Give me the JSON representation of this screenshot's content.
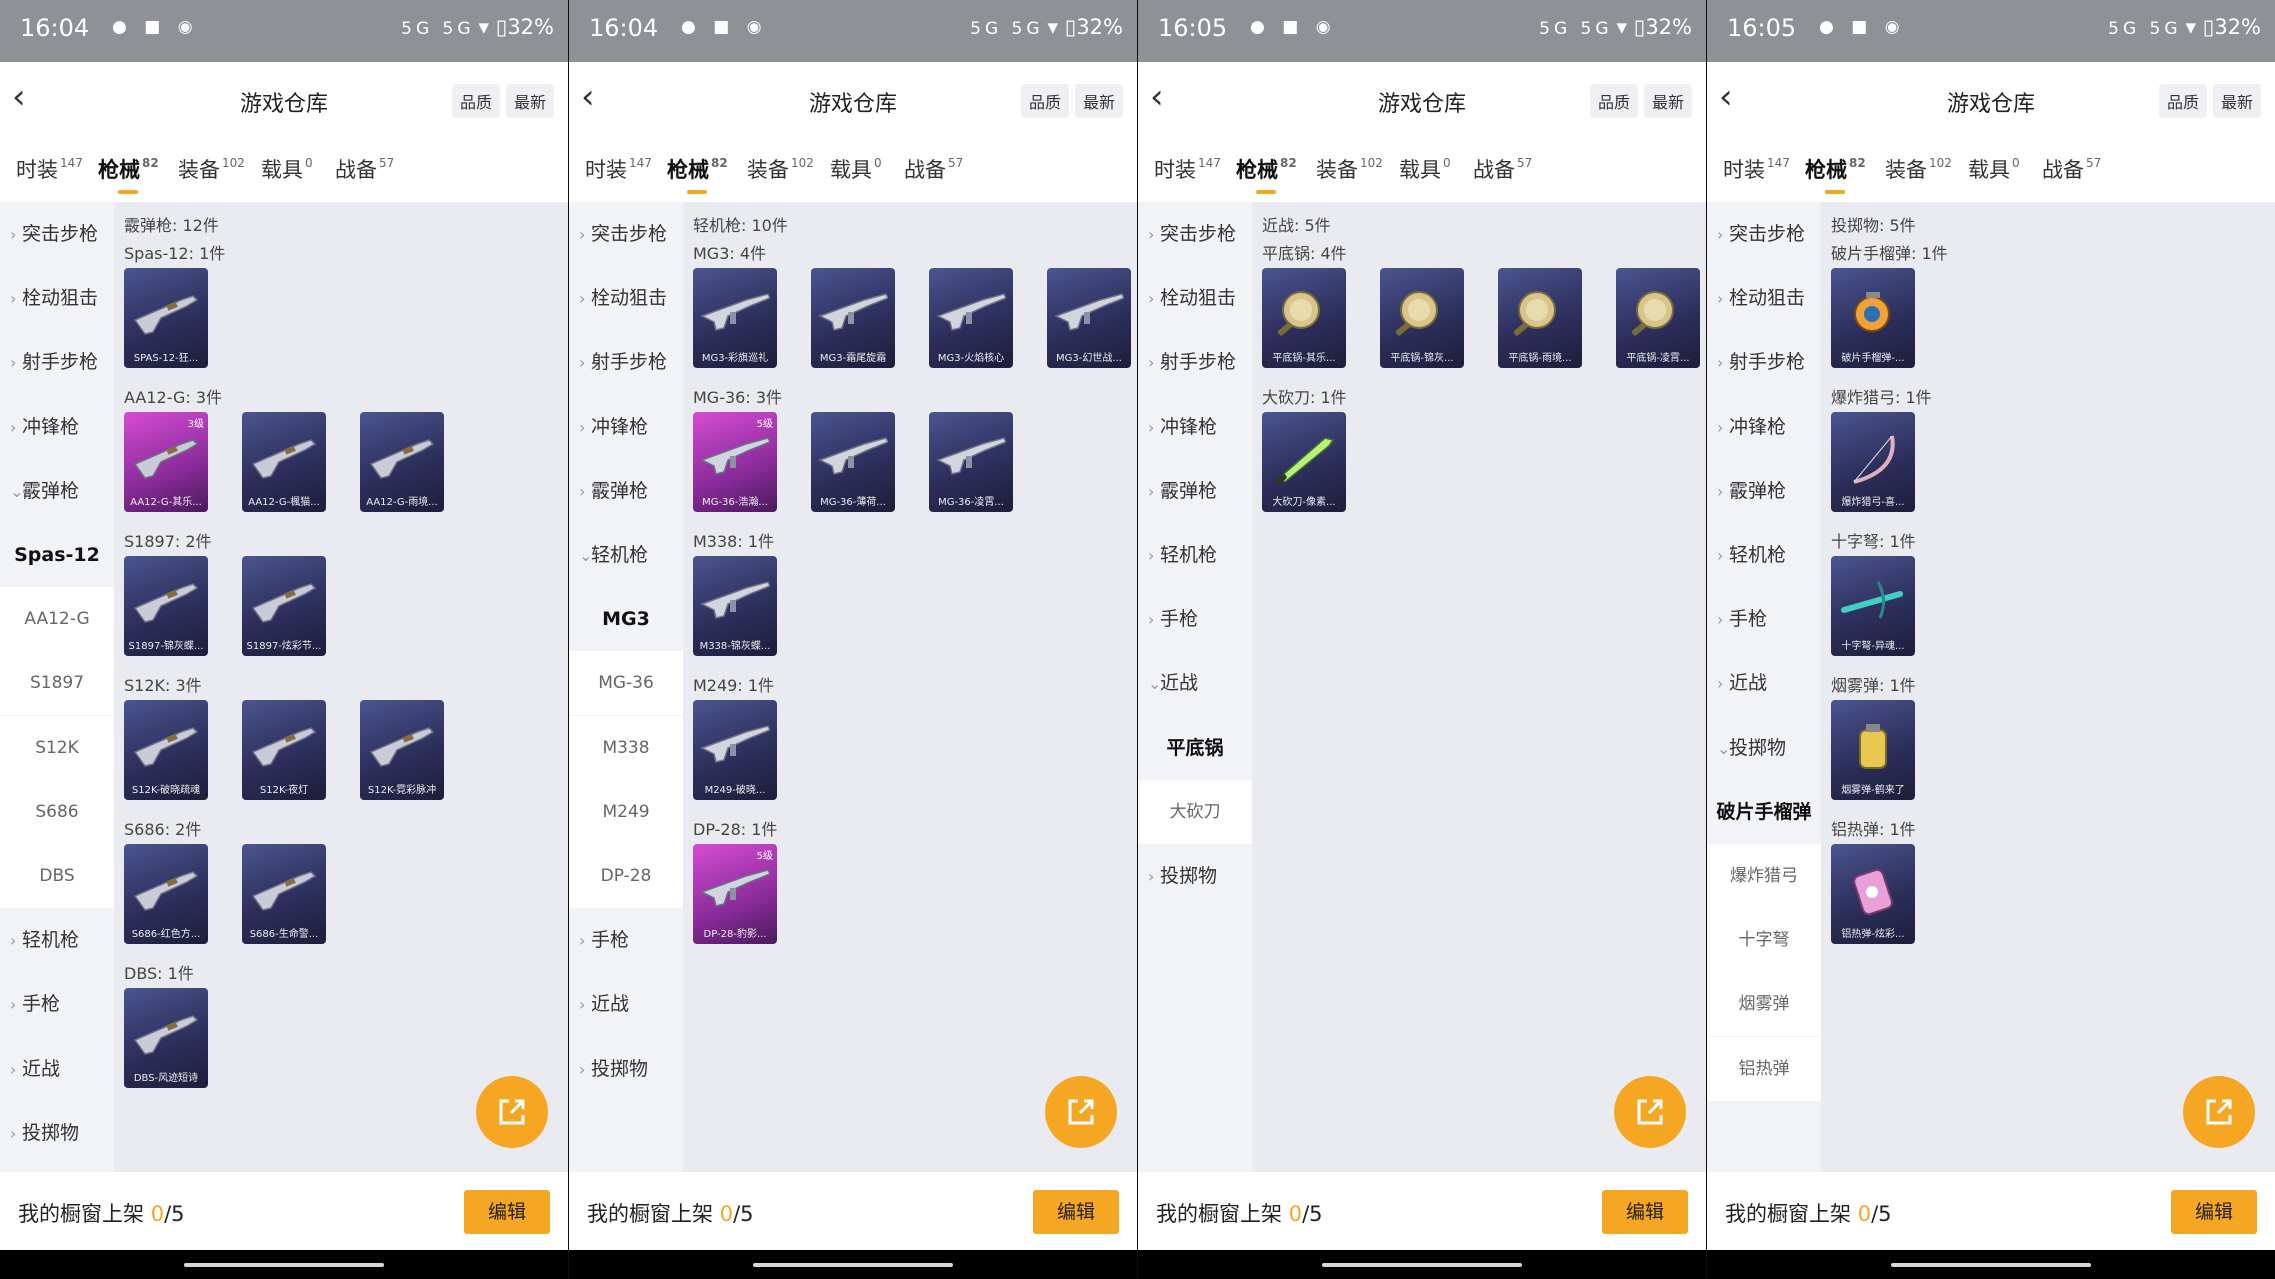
{
  "colors": {
    "accent": "#f5a623",
    "rare_purple": "#4b5590",
    "rare_pink": "#d54cd2"
  },
  "status": {
    "signal_text": "5G 5G",
    "battery": "32%",
    "battery_icon": "battery-icon",
    "wifi_icon": "wifi-icon"
  },
  "nav": {
    "title": "游戏仓库",
    "sort_quality": "品质",
    "sort_latest": "最新",
    "back_icon": "chevron-left-icon"
  },
  "tabs": [
    {
      "label": "时装",
      "count": "147"
    },
    {
      "label": "枪械",
      "count": "82"
    },
    {
      "label": "装备",
      "count": "102"
    },
    {
      "label": "载具",
      "count": "0"
    },
    {
      "label": "战备",
      "count": "57"
    }
  ],
  "bottom": {
    "prefix": "我的橱窗上架 ",
    "count": "0",
    "total": "/5",
    "edit_label": "编辑",
    "share_icon": "share-icon"
  },
  "screens": [
    {
      "time": "16:04",
      "sidebar": [
        {
          "label": "突击步枪",
          "type": "cat",
          "chev": "›"
        },
        {
          "label": "栓动狙击",
          "type": "cat",
          "chev": "›"
        },
        {
          "label": "射手步枪",
          "type": "cat",
          "chev": "›"
        },
        {
          "label": "冲锋枪",
          "type": "cat",
          "chev": "›"
        },
        {
          "label": "霰弹枪",
          "type": "cat",
          "chev": "⌄"
        },
        {
          "label": "Spas-12",
          "type": "sub",
          "selected": true
        },
        {
          "label": "AA12-G",
          "type": "sub"
        },
        {
          "label": "S1897",
          "type": "sub"
        },
        {
          "label": "S12K",
          "type": "sub"
        },
        {
          "label": "S686",
          "type": "sub"
        },
        {
          "label": "DBS",
          "type": "sub"
        },
        {
          "label": "轻机枪",
          "type": "cat",
          "chev": "›"
        },
        {
          "label": "手枪",
          "type": "cat",
          "chev": "›"
        },
        {
          "label": "近战",
          "type": "cat",
          "chev": "›"
        },
        {
          "label": "投掷物",
          "type": "cat",
          "chev": "›"
        }
      ],
      "summary": "霰弹枪: 12件",
      "groups": [
        {
          "label": "Spas-12: 1件",
          "items": [
            {
              "name": "SPAS-12-狂...",
              "rarity": "r4",
              "icon": "shotgun-icon"
            }
          ]
        },
        {
          "label": "AA12-G: 3件",
          "items": [
            {
              "name": "AA12-G-其乐...",
              "rarity": "r5",
              "badge": "3级",
              "icon": "shotgun-icon"
            },
            {
              "name": "AA12-G-楓猫...",
              "rarity": "r4",
              "icon": "shotgun-icon"
            },
            {
              "name": "AA12-G-雨境...",
              "rarity": "r4",
              "icon": "shotgun-icon"
            }
          ]
        },
        {
          "label": "S1897: 2件",
          "items": [
            {
              "name": "S1897-锦灰蝶...",
              "rarity": "r4",
              "icon": "shotgun-icon"
            },
            {
              "name": "S1897-炫彩节...",
              "rarity": "r4",
              "icon": "shotgun-icon"
            }
          ]
        },
        {
          "label": "S12K: 3件",
          "items": [
            {
              "name": "S12K-破晓疏魂",
              "rarity": "r4",
              "icon": "shotgun-icon"
            },
            {
              "name": "S12K-夜灯",
              "rarity": "r4",
              "icon": "shotgun-icon"
            },
            {
              "name": "S12K-霓彩脉冲",
              "rarity": "r4",
              "icon": "shotgun-icon"
            }
          ]
        },
        {
          "label": "S686: 2件",
          "items": [
            {
              "name": "S686-红色方...",
              "rarity": "r4",
              "icon": "shotgun-icon"
            },
            {
              "name": "S686-生命警...",
              "rarity": "r4",
              "icon": "shotgun-icon"
            }
          ]
        },
        {
          "label": "DBS: 1件",
          "items": [
            {
              "name": "DBS-风迹短诗",
              "rarity": "r4",
              "icon": "shotgun-icon"
            }
          ]
        }
      ]
    },
    {
      "time": "16:04",
      "sidebar": [
        {
          "label": "突击步枪",
          "type": "cat",
          "chev": "›"
        },
        {
          "label": "栓动狙击",
          "type": "cat",
          "chev": "›"
        },
        {
          "label": "射手步枪",
          "type": "cat",
          "chev": "›"
        },
        {
          "label": "冲锋枪",
          "type": "cat",
          "chev": "›"
        },
        {
          "label": "霰弹枪",
          "type": "cat",
          "chev": "›"
        },
        {
          "label": "轻机枪",
          "type": "cat",
          "chev": "⌄"
        },
        {
          "label": "MG3",
          "type": "sub",
          "selected": true
        },
        {
          "label": "MG-36",
          "type": "sub"
        },
        {
          "label": "M338",
          "type": "sub"
        },
        {
          "label": "M249",
          "type": "sub"
        },
        {
          "label": "DP-28",
          "type": "sub"
        },
        {
          "label": "手枪",
          "type": "cat",
          "chev": "›"
        },
        {
          "label": "近战",
          "type": "cat",
          "chev": "›"
        },
        {
          "label": "投掷物",
          "type": "cat",
          "chev": "›"
        }
      ],
      "summary": "轻机枪: 10件",
      "groups": [
        {
          "label": "MG3: 4件",
          "items": [
            {
              "name": "MG3-彩旗巡礼",
              "rarity": "r4",
              "icon": "machinegun-icon"
            },
            {
              "name": "MG3-霜尾旋霜",
              "rarity": "r4",
              "icon": "machinegun-icon"
            },
            {
              "name": "MG3-火焰核心",
              "rarity": "r4",
              "icon": "machinegun-icon"
            },
            {
              "name": "MG3-幻世战...",
              "rarity": "r4",
              "icon": "machinegun-icon"
            }
          ]
        },
        {
          "label": "MG-36: 3件",
          "items": [
            {
              "name": "MG-36-浩瀚...",
              "rarity": "r5",
              "badge": "5级",
              "icon": "machinegun-icon"
            },
            {
              "name": "MG-36-薄荷...",
              "rarity": "r4",
              "icon": "machinegun-icon"
            },
            {
              "name": "MG-36-凌霄...",
              "rarity": "r4",
              "icon": "machinegun-icon"
            }
          ]
        },
        {
          "label": "M338: 1件",
          "items": [
            {
              "name": "M338-锦灰蝶...",
              "rarity": "r4",
              "icon": "machinegun-icon"
            }
          ]
        },
        {
          "label": "M249: 1件",
          "items": [
            {
              "name": "M249-破晓...",
              "rarity": "r4",
              "icon": "machinegun-icon"
            }
          ]
        },
        {
          "label": "DP-28: 1件",
          "items": [
            {
              "name": "DP-28-豹影...",
              "rarity": "r5",
              "badge": "5级",
              "icon": "machinegun-icon"
            }
          ]
        }
      ]
    },
    {
      "time": "16:05",
      "sidebar": [
        {
          "label": "突击步枪",
          "type": "cat",
          "chev": "›"
        },
        {
          "label": "栓动狙击",
          "type": "cat",
          "chev": "›"
        },
        {
          "label": "射手步枪",
          "type": "cat",
          "chev": "›"
        },
        {
          "label": "冲锋枪",
          "type": "cat",
          "chev": "›"
        },
        {
          "label": "霰弹枪",
          "type": "cat",
          "chev": "›"
        },
        {
          "label": "轻机枪",
          "type": "cat",
          "chev": "›"
        },
        {
          "label": "手枪",
          "type": "cat",
          "chev": "›"
        },
        {
          "label": "近战",
          "type": "cat",
          "chev": "⌄"
        },
        {
          "label": "平底锅",
          "type": "sub",
          "selected": true
        },
        {
          "label": "大砍刀",
          "type": "sub"
        },
        {
          "label": "投掷物",
          "type": "cat",
          "chev": "›"
        }
      ],
      "summary": "近战: 5件",
      "groups": [
        {
          "label": "平底锅: 4件",
          "items": [
            {
              "name": "平底锅-其乐...",
              "rarity": "r4",
              "icon": "pan-icon"
            },
            {
              "name": "平底锅-锦灰...",
              "rarity": "r4",
              "icon": "pan-icon"
            },
            {
              "name": "平底锅-雨境...",
              "rarity": "r4",
              "icon": "pan-icon"
            },
            {
              "name": "平底锅-凌霄...",
              "rarity": "r4",
              "icon": "pan-icon"
            }
          ]
        },
        {
          "label": "大砍刀: 1件",
          "items": [
            {
              "name": "大砍刀-像素...",
              "rarity": "r4",
              "icon": "machete-icon"
            }
          ]
        }
      ]
    },
    {
      "time": "16:05",
      "sidebar": [
        {
          "label": "突击步枪",
          "type": "cat",
          "chev": "›"
        },
        {
          "label": "栓动狙击",
          "type": "cat",
          "chev": "›"
        },
        {
          "label": "射手步枪",
          "type": "cat",
          "chev": "›"
        },
        {
          "label": "冲锋枪",
          "type": "cat",
          "chev": "›"
        },
        {
          "label": "霰弹枪",
          "type": "cat",
          "chev": "›"
        },
        {
          "label": "轻机枪",
          "type": "cat",
          "chev": "›"
        },
        {
          "label": "手枪",
          "type": "cat",
          "chev": "›"
        },
        {
          "label": "近战",
          "type": "cat",
          "chev": "›"
        },
        {
          "label": "投掷物",
          "type": "cat",
          "chev": "⌄"
        },
        {
          "label": "破片手榴弹",
          "type": "sub",
          "selected": true
        },
        {
          "label": "爆炸猎弓",
          "type": "sub"
        },
        {
          "label": "十字弩",
          "type": "sub"
        },
        {
          "label": "烟雾弹",
          "type": "sub"
        },
        {
          "label": "铝热弹",
          "type": "sub"
        }
      ],
      "summary": "投掷物: 5件",
      "groups": [
        {
          "label": "破片手榴弹: 1件",
          "items": [
            {
              "name": "破片手榴弹-...",
              "rarity": "r4",
              "icon": "grenade-icon"
            }
          ]
        },
        {
          "label": "爆炸猎弓: 1件",
          "items": [
            {
              "name": "爆炸猎弓-喜...",
              "rarity": "r4",
              "icon": "bow-icon"
            }
          ]
        },
        {
          "label": "十字弩: 1件",
          "items": [
            {
              "name": "十字弩-异魂...",
              "rarity": "r4",
              "icon": "crossbow-icon"
            }
          ]
        },
        {
          "label": "烟雾弹: 1件",
          "items": [
            {
              "name": "烟雾弹-鹤来了",
              "rarity": "r4",
              "icon": "smoke-grenade-icon"
            }
          ]
        },
        {
          "label": "铝热弹: 1件",
          "items": [
            {
              "name": "铝热弹-炫彩...",
              "rarity": "r4",
              "icon": "thermite-icon"
            }
          ]
        }
      ]
    }
  ]
}
